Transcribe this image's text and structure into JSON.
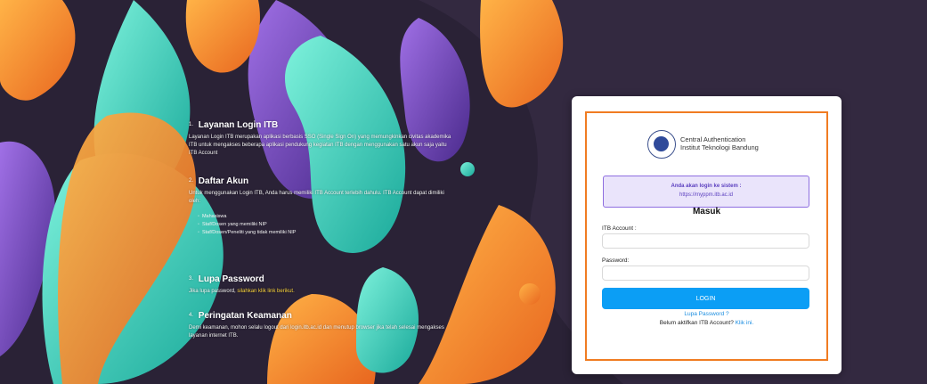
{
  "colors": {
    "background": "#2a2236",
    "frame": "#f07c22",
    "notice_border": "#8e6ee0",
    "notice_bg": "#eae4fb",
    "notice_text": "#5b3fbf",
    "login_button": "#0b9ef5",
    "link": "#1a8de0",
    "highlight_link": "#f7d23a"
  },
  "info": {
    "sections": [
      {
        "num": "1.",
        "title": "Layanan Login ITB",
        "body": "Layanan Login ITB merupakan aplikasi berbasis SSO (Single Sign On) yang memungkinkan civitas akademika ITB untuk mengakses beberapa aplikasi pendukung kegiatan ITB dengan menggunakan satu akun saja yaitu ITB Account"
      },
      {
        "num": "2.",
        "title": "Daftar Akun",
        "body": "Untuk menggunakan Login ITB, Anda harus memiliki ITB Account terlebih dahulu. ITB Account dapat dimiliki oleh:",
        "list": [
          "Mahasiswa",
          "Staf/Dosen yang memiliki NIP",
          "Staf/Dosen/Peneliti yang tidak memiliki NIP"
        ]
      },
      {
        "num": "3.",
        "title": "Lupa Password",
        "body": "Jika lupa password, ",
        "link": "silahkan klik link berikut."
      },
      {
        "num": "4.",
        "title": "Peringatan Keamanan",
        "body": "Demi keamanan, mohon selalu logout dari login.itb.ac.id dan menutup browser jika telah selesai mengakses layanan internet ITB."
      }
    ]
  },
  "login": {
    "brand_line1": "Central Authentication",
    "brand_line2": "Institut Teknologi Bandung",
    "seal_icon": "itb-seal-icon",
    "notice_line1": "Anda akan login ke sistem :",
    "notice_line2": "https://myppm.itb.ac.id",
    "heading": "Masuk",
    "account_label": "ITB Account :",
    "account_value": "",
    "password_label": "Password:",
    "password_value": "",
    "login_button": "LOGIN",
    "forgot_link": "Lupa Password ?",
    "activate_text": "Belum aktifkan ITB Account? ",
    "activate_link": "Klik ini."
  }
}
